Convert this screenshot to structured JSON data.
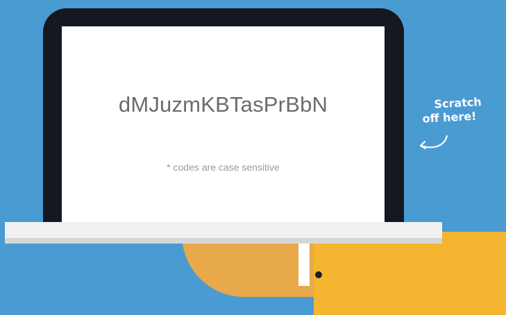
{
  "card": {
    "code": "dMJuzmKBTasPrBbN",
    "note": "* codes are case sensitive"
  },
  "scratch_hint": {
    "line1": "Scratch",
    "line2": "off here!"
  },
  "icons": {
    "arrow": "curved-arrow-icon"
  },
  "colors": {
    "background": "#4a9bd1",
    "bezel": "#141821",
    "screen": "#ffffff",
    "code_text": "#6b6b6b",
    "note_text": "#9a9a9a",
    "orange": "#f4b531"
  }
}
